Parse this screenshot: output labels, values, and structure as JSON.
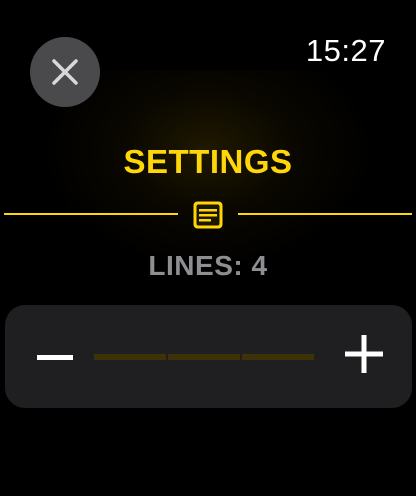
{
  "status_bar": {
    "time": "15:27"
  },
  "close_button": {
    "icon": "close-icon"
  },
  "settings": {
    "title": "SETTINGS",
    "divider_icon": "note-icon",
    "lines_label": "LINES: 4",
    "lines_value": 4,
    "stepper": {
      "decrement_icon": "minus-icon",
      "increment_icon": "plus-icon",
      "segments": 3
    }
  },
  "colors": {
    "accent": "#ffd60a",
    "label": "#8e8e93",
    "button_bg": "#4a4a4c",
    "stepper_bg": "#1f1f21",
    "track_segment": "#3b3306"
  }
}
